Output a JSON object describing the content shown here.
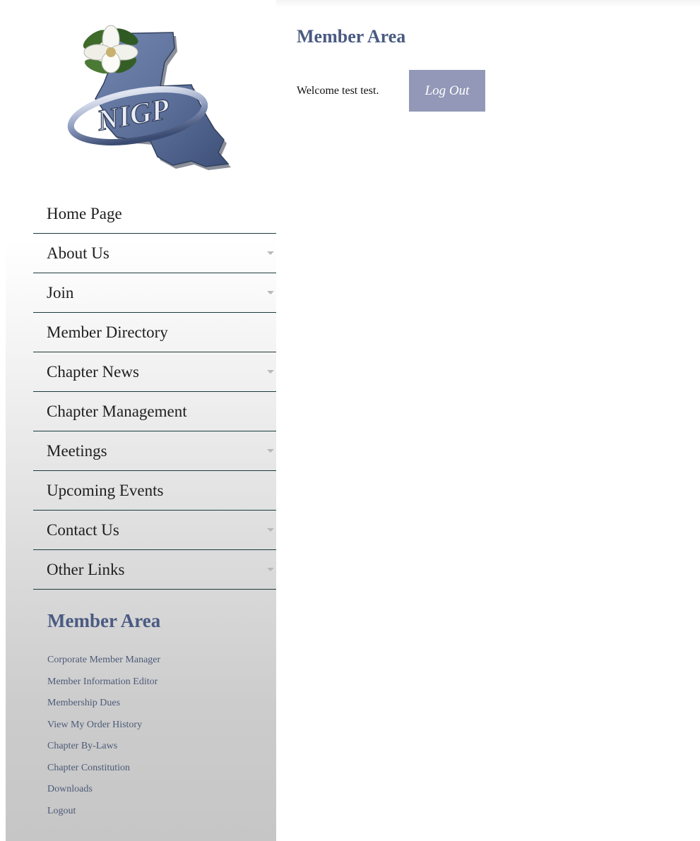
{
  "logo": {
    "text": "NIGP",
    "alt": "NIGP Louisiana chapter logo"
  },
  "nav": {
    "items": [
      {
        "label": "Home Page",
        "has_submenu": false
      },
      {
        "label": "About Us",
        "has_submenu": true
      },
      {
        "label": "Join",
        "has_submenu": true
      },
      {
        "label": "Member Directory",
        "has_submenu": false
      },
      {
        "label": "Chapter News",
        "has_submenu": true
      },
      {
        "label": "Chapter Management",
        "has_submenu": false
      },
      {
        "label": "Meetings",
        "has_submenu": true
      },
      {
        "label": "Upcoming Events",
        "has_submenu": false
      },
      {
        "label": "Contact Us",
        "has_submenu": true
      },
      {
        "label": "Other Links",
        "has_submenu": true
      }
    ]
  },
  "member_area": {
    "heading": "Member Area",
    "links": [
      "Corporate Member Manager",
      "Member Information Editor",
      "Membership Dues",
      "View My Order History",
      "Chapter By-Laws",
      "Chapter Constitution",
      "Downloads",
      "Logout"
    ]
  },
  "main": {
    "title": "Member Area",
    "welcome": "Welcome test test.",
    "logout_label": "Log Out"
  },
  "colors": {
    "heading": "#4a5a82",
    "button": "#9398b8",
    "nav_border": "#1c3a3a",
    "logo_state": "#5a6e98"
  }
}
